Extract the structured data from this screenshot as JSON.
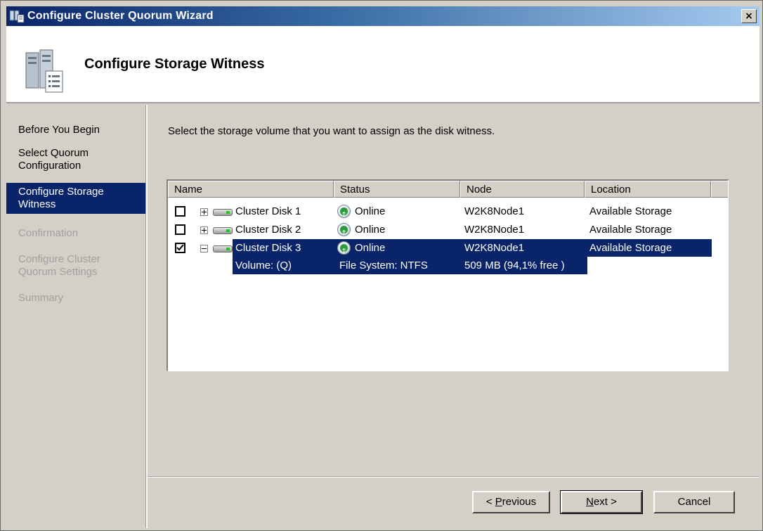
{
  "window": {
    "title": "Configure Cluster Quorum Wizard",
    "close_glyph": "×"
  },
  "header": {
    "title": "Configure Storage Witness"
  },
  "nav": {
    "items": [
      {
        "label": "Before You Begin",
        "state": "normal"
      },
      {
        "label": "Select Quorum Configuration",
        "state": "normal"
      },
      {
        "label": "Configure Storage Witness",
        "state": "active"
      },
      {
        "label": "Confirmation",
        "state": "disabled"
      },
      {
        "label": "Configure Cluster Quorum Settings",
        "state": "disabled"
      },
      {
        "label": "Summary",
        "state": "disabled"
      }
    ]
  },
  "main": {
    "instruction": "Select the storage volume that you want to assign as the disk witness.",
    "columns": [
      "Name",
      "Status",
      "Node",
      "Location"
    ],
    "rows": [
      {
        "name": "Cluster Disk 1",
        "status": "Online",
        "node": "W2K8Node1",
        "location": "Available Storage",
        "checked": false,
        "expanded": false
      },
      {
        "name": "Cluster Disk 2",
        "status": "Online",
        "node": "W2K8Node1",
        "location": "Available Storage",
        "checked": false,
        "expanded": false
      },
      {
        "name": "Cluster Disk 3",
        "status": "Online",
        "node": "W2K8Node1",
        "location": "Available Storage",
        "checked": true,
        "expanded": true
      }
    ],
    "detail": {
      "volume": "Volume: (Q)",
      "filesystem": "File System: NTFS",
      "size": "509 MB (94,1% free )"
    }
  },
  "buttons": {
    "previous_prefix": "< ",
    "previous_accel": "P",
    "previous_rest": "revious",
    "next_accel": "N",
    "next_rest": "ext >",
    "cancel": "Cancel"
  },
  "colors": {
    "selection": "#0a246a",
    "face": "#d4d0c8",
    "status_ok": "#2e9b3a"
  }
}
